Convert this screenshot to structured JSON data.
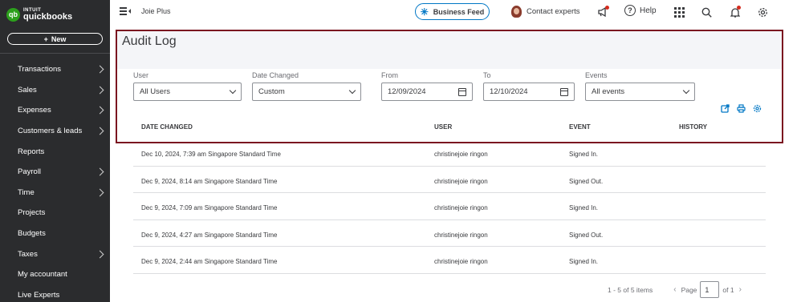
{
  "sidebar": {
    "logo_top": "INTUIT",
    "logo_bottom": "quickbooks",
    "logo_badge": "qb",
    "new_label": "New",
    "items": [
      {
        "label": "Transactions",
        "has_chevron": true
      },
      {
        "label": "Sales",
        "has_chevron": true
      },
      {
        "label": "Expenses",
        "has_chevron": true
      },
      {
        "label": "Customers & leads",
        "has_chevron": true
      },
      {
        "label": "Reports",
        "has_chevron": false
      },
      {
        "label": "Payroll",
        "has_chevron": true
      },
      {
        "label": "Time",
        "has_chevron": true
      },
      {
        "label": "Projects",
        "has_chevron": false
      },
      {
        "label": "Budgets",
        "has_chevron": false
      },
      {
        "label": "Taxes",
        "has_chevron": true
      },
      {
        "label": "My accountant",
        "has_chevron": false
      },
      {
        "label": "Live Experts",
        "has_chevron": false
      }
    ]
  },
  "topbar": {
    "company_name": "Joie Plus",
    "business_feed_label": "Business Feed",
    "contact_label": "Contact experts",
    "help_label": "Help"
  },
  "audit": {
    "title": "Audit Log",
    "filters": {
      "user_label": "User",
      "user_value": "All Users",
      "date_changed_label": "Date Changed",
      "date_changed_value": "Custom",
      "from_label": "From",
      "from_value": "12/09/2024",
      "to_label": "To",
      "to_value": "12/10/2024",
      "events_label": "Events",
      "events_value": "All events"
    },
    "columns": {
      "date_changed": "DATE CHANGED",
      "user": "USER",
      "event": "EVENT",
      "history": "HISTORY"
    },
    "rows": [
      {
        "date": "Dec 10, 2024, 7:39 am Singapore Standard Time",
        "user": "christinejoie ringon",
        "event": "Signed In."
      },
      {
        "date": "Dec 9, 2024, 8:14 am Singapore Standard Time",
        "user": "christinejoie ringon",
        "event": "Signed Out."
      },
      {
        "date": "Dec 9, 2024, 7:09 am Singapore Standard Time",
        "user": "christinejoie ringon",
        "event": "Signed In."
      },
      {
        "date": "Dec 9, 2024, 4:27 am Singapore Standard Time",
        "user": "christinejoie ringon",
        "event": "Signed Out."
      },
      {
        "date": "Dec 9, 2024, 2:44 am Singapore Standard Time",
        "user": "christinejoie ringon",
        "event": "Signed In."
      }
    ],
    "pagination": {
      "count_text": "1 - 5 of 5 items",
      "page_label": "Page",
      "page_value": "1",
      "of_text": "of 1"
    }
  },
  "colors": {
    "sidebar_bg": "#2b2c2e",
    "accent_blue": "#0077c5",
    "brand_green": "#2ca01c",
    "highlight_border": "#7b1520"
  },
  "icons": [
    "hamburger-collapse-icon",
    "sparkle-icon",
    "megaphone-icon",
    "help-icon",
    "app-grid-icon",
    "search-icon",
    "notification-bell-icon",
    "settings-gear-icon",
    "calendar-icon",
    "export-icon",
    "print-icon",
    "table-settings-icon"
  ]
}
